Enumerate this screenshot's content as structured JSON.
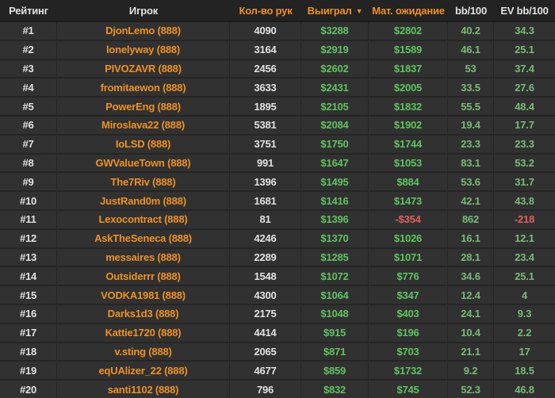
{
  "colors": {
    "accent_orange": "#ee9222",
    "money_green": "#60c360",
    "bb_green": "#79ba79",
    "negative_red": "#e05f5f",
    "row_bg": "#313131",
    "header_bg": "#232323"
  },
  "header": {
    "rank": "Рейтинг",
    "player": "Игрок",
    "hands": "Кол-во рук",
    "won": "Выиграл",
    "sort_icon": "▼",
    "ev": "Мат. ожидание",
    "bb100": "bb/100",
    "ev_bb100": "EV bb/100"
  },
  "rows": [
    {
      "rank": "#1",
      "player": "DjonLemo (888)",
      "hands": "4090",
      "won": "$3288",
      "ev": "$2802",
      "bb100": "40.2",
      "ev_bb100": "34.3"
    },
    {
      "rank": "#2",
      "player": "lonelyway (888)",
      "hands": "3164",
      "won": "$2919",
      "ev": "$1589",
      "bb100": "46.1",
      "ev_bb100": "25.1"
    },
    {
      "rank": "#3",
      "player": "PIVOZAVR (888)",
      "hands": "2456",
      "won": "$2602",
      "ev": "$1837",
      "bb100": "53",
      "ev_bb100": "37.4"
    },
    {
      "rank": "#4",
      "player": "fromitaewon (888)",
      "hands": "3633",
      "won": "$2431",
      "ev": "$2005",
      "bb100": "33.5",
      "ev_bb100": "27.6"
    },
    {
      "rank": "#5",
      "player": "PowerEng (888)",
      "hands": "1895",
      "won": "$2105",
      "ev": "$1832",
      "bb100": "55.5",
      "ev_bb100": "48.4"
    },
    {
      "rank": "#6",
      "player": "Miroslava22 (888)",
      "hands": "5381",
      "won": "$2084",
      "ev": "$1902",
      "bb100": "19.4",
      "ev_bb100": "17.7"
    },
    {
      "rank": "#7",
      "player": "IoLSD (888)",
      "hands": "3751",
      "won": "$1750",
      "ev": "$1744",
      "bb100": "23.3",
      "ev_bb100": "23.3"
    },
    {
      "rank": "#8",
      "player": "GWValueTown (888)",
      "hands": "991",
      "won": "$1647",
      "ev": "$1053",
      "bb100": "83.1",
      "ev_bb100": "53.2"
    },
    {
      "rank": "#9",
      "player": "The7Riv (888)",
      "hands": "1396",
      "won": "$1495",
      "ev": "$884",
      "bb100": "53.6",
      "ev_bb100": "31.7"
    },
    {
      "rank": "#10",
      "player": "JustRand0m (888)",
      "hands": "1681",
      "won": "$1416",
      "ev": "$1473",
      "bb100": "42.1",
      "ev_bb100": "43.8"
    },
    {
      "rank": "#11",
      "player": "Lexocontract (888)",
      "hands": "81",
      "won": "$1396",
      "ev": "-$354",
      "bb100": "862",
      "ev_bb100": "-218"
    },
    {
      "rank": "#12",
      "player": "AskTheSeneca (888)",
      "hands": "4246",
      "won": "$1370",
      "ev": "$1026",
      "bb100": "16.1",
      "ev_bb100": "12.1"
    },
    {
      "rank": "#13",
      "player": "messaires (888)",
      "hands": "2289",
      "won": "$1285",
      "ev": "$1071",
      "bb100": "28.1",
      "ev_bb100": "23.4"
    },
    {
      "rank": "#14",
      "player": "Outsiderrr (888)",
      "hands": "1548",
      "won": "$1072",
      "ev": "$776",
      "bb100": "34.6",
      "ev_bb100": "25.1"
    },
    {
      "rank": "#15",
      "player": "VODKA1981 (888)",
      "hands": "4300",
      "won": "$1064",
      "ev": "$347",
      "bb100": "12.4",
      "ev_bb100": "4"
    },
    {
      "rank": "#16",
      "player": "Darks1d3 (888)",
      "hands": "2175",
      "won": "$1048",
      "ev": "$403",
      "bb100": "24.1",
      "ev_bb100": "9.3"
    },
    {
      "rank": "#17",
      "player": "Kattie1720 (888)",
      "hands": "4414",
      "won": "$915",
      "ev": "$196",
      "bb100": "10.4",
      "ev_bb100": "2.2"
    },
    {
      "rank": "#18",
      "player": "v.sting (888)",
      "hands": "2065",
      "won": "$871",
      "ev": "$703",
      "bb100": "21.1",
      "ev_bb100": "17"
    },
    {
      "rank": "#19",
      "player": "eqUAlizer_22 (888)",
      "hands": "4677",
      "won": "$859",
      "ev": "$1732",
      "bb100": "9.2",
      "ev_bb100": "18.5"
    },
    {
      "rank": "#20",
      "player": "santi1102 (888)",
      "hands": "796",
      "won": "$832",
      "ev": "$745",
      "bb100": "52.3",
      "ev_bb100": "46.8"
    }
  ]
}
